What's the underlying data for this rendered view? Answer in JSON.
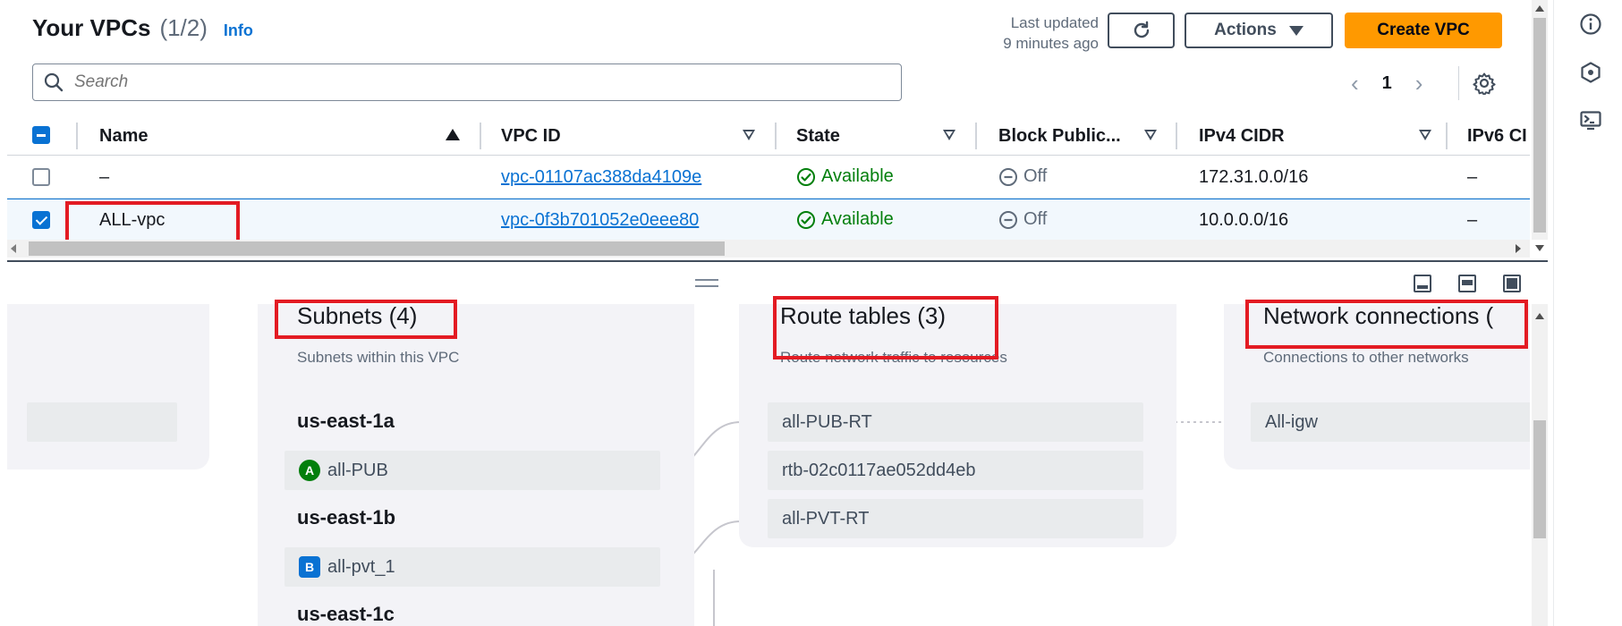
{
  "header": {
    "title": "Your VPCs",
    "count": "(1/2)",
    "info_link": "Info",
    "last_updated_line1": "Last updated",
    "last_updated_line2": "9 minutes ago",
    "actions_label": "Actions",
    "create_label": "Create VPC"
  },
  "search": {
    "placeholder": "Search"
  },
  "pagination": {
    "current_page": "1"
  },
  "table": {
    "columns": [
      "Name",
      "VPC ID",
      "State",
      "Block Public...",
      "IPv4 CIDR",
      "IPv6 CI"
    ],
    "rows": [
      {
        "name": "–",
        "vpc_id": "vpc-01107ac388da4109e",
        "state": "Available",
        "block_public": "Off",
        "ipv4": "172.31.0.0/16",
        "ipv6": "–",
        "selected": false
      },
      {
        "name": "ALL-vpc",
        "vpc_id": "vpc-0f3b701052e0eee80",
        "state": "Available",
        "block_public": "Off",
        "ipv4": "10.0.0.0/16",
        "ipv6": "–",
        "selected": true
      }
    ]
  },
  "resource_map": {
    "subnets": {
      "title": "Subnets (4)",
      "subtitle": "Subnets within this VPC",
      "zones": [
        {
          "az": "us-east-1a",
          "subnet": "all-PUB",
          "badge": "A"
        },
        {
          "az": "us-east-1b",
          "subnet": "all-pvt_1",
          "badge": "B"
        },
        {
          "az": "us-east-1c"
        }
      ]
    },
    "route_tables": {
      "title": "Route tables (3)",
      "subtitle": "Route network traffic to resources",
      "items": [
        "all-PUB-RT",
        "rtb-02c0117ae052dd4eb",
        "all-PVT-RT"
      ]
    },
    "network_connections": {
      "title": "Network connections (",
      "subtitle": "Connections to other networks",
      "items": [
        "All-igw"
      ]
    }
  },
  "colors": {
    "accent": "#0972d3",
    "primary_button": "#ff9900",
    "available_green": "#037f0c",
    "highlight_red": "#e31b23"
  }
}
